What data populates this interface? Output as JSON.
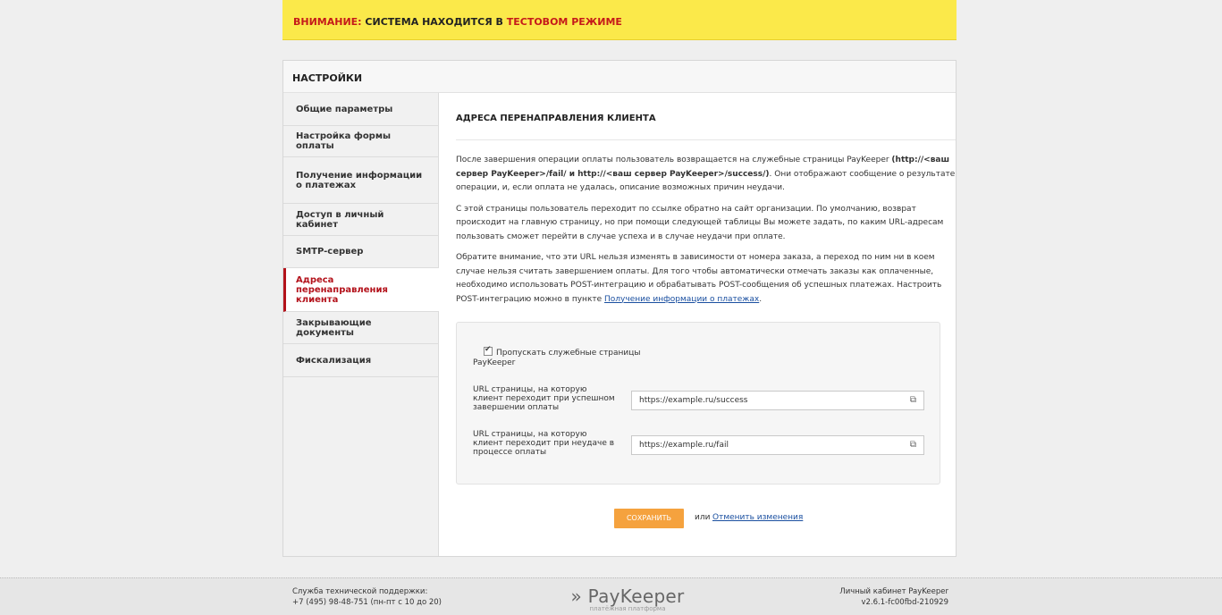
{
  "warning": {
    "part1": "ВНИМАНИЕ:",
    "part2": " СИСТЕМА НАХОДИТСЯ В ",
    "part3": "ТЕСТОВОМ РЕЖИМЕ"
  },
  "panel": {
    "title": "НАСТРОЙКИ"
  },
  "sidebar": {
    "items": [
      {
        "label": "Общие параметры"
      },
      {
        "label": "Настройка формы оплаты"
      },
      {
        "label": "Получение информации о платежах"
      },
      {
        "label": "Доступ в личный кабинет"
      },
      {
        "label": "SMTP-сервер"
      },
      {
        "label": "Адреса перенаправления клиента"
      },
      {
        "label": "Закрывающие документы"
      },
      {
        "label": "Фискализация"
      }
    ]
  },
  "content": {
    "title": "АДРЕСА ПЕРЕНАПРАВЛЕНИЯ КЛИЕНТА",
    "p1_a": "После завершения операции оплаты пользователь возвращается на служебные страницы PayKeeper ",
    "p1_b": "(http://<ваш сервер PayKeeper>/fail/ и http://<ваш сервер PayKeeper>/success/)",
    "p1_c": ". Они отображают сообщение о результате операции, и, если оплата не удалась, описание возможных причин неудачи.",
    "p2": "С этой страницы пользователь переходит по ссылке обратно на сайт организации. По умолчанию, возврат происходит на главную страницу, но при помощи следующей таблицы Вы можете задать, по каким URL-адресам пользовать сможет перейти в случае успеха и в случае неудачи при оплате.",
    "p3": "Обратите внимание, что эти URL нельзя изменять в зависимости от номера заказа, а переход по ним ни в коем случае нельзя считать завершением оплаты. Для того чтобы автоматически отмечать заказы как оплаченные, необходимо использовать POST-интеграцию и обрабатывать POST-сообщения об успешных платежах. Настроить POST-интеграцию можно в пункте ",
    "p3_link": "Получение информации о платежах",
    "p3_end": "."
  },
  "form": {
    "skip_label": "Пропускать служебные страницы PayKeeper",
    "skip_checked": true,
    "success_label": "URL страницы, на которую клиент переходит при успешном завершении оплаты",
    "success_value": "https://example.ru/success",
    "fail_label": "URL страницы, на которую клиент переходит при неудаче в процессе оплаты",
    "fail_value": "https://example.ru/fail"
  },
  "actions": {
    "save": "СОХРАНИТЬ",
    "or": "или",
    "cancel": "Отменить изменения"
  },
  "footer": {
    "support_title": "Служба технической поддержки:",
    "support_phone": "+7 (495) 98-48-751 (пн-пт с 10 до 20)",
    "logo": "PayKeeper",
    "logo_sub": "платёжная платформа",
    "cabinet": "Личный кабинет PayKeeper",
    "version": "v2.6.1-fc00fbd-210929"
  }
}
